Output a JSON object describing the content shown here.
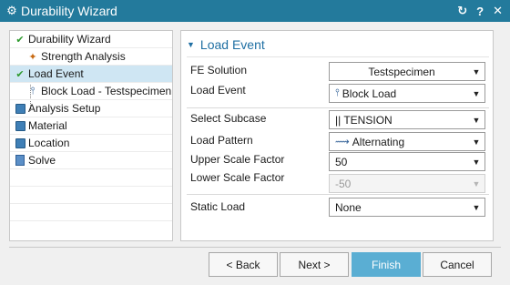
{
  "window": {
    "title": "Durability Wizard",
    "controls": [
      "↻",
      "?",
      "✕"
    ]
  },
  "tree": {
    "items": [
      {
        "label": "Durability Wizard",
        "icon": "check-icon",
        "indent": 0
      },
      {
        "label": "Strength Analysis",
        "icon": "strength-analysis-icon",
        "indent": 1
      },
      {
        "label": "Load Event",
        "icon": "check-icon",
        "indent": 0,
        "selected": true
      },
      {
        "label": "Block Load - Testspecimen",
        "icon": "block-load-icon",
        "indent": 1
      },
      {
        "label": "Analysis Setup",
        "icon": "setup-icon",
        "indent": 0
      },
      {
        "label": "Material",
        "icon": "material-icon",
        "indent": 0
      },
      {
        "label": "Location",
        "icon": "location-icon",
        "indent": 0
      },
      {
        "label": "Solve",
        "icon": "solve-icon",
        "indent": 0
      }
    ]
  },
  "load_event": {
    "section_title": "Load Event",
    "fe_solution_label": "FE Solution",
    "fe_solution_value": "Testspecimen",
    "load_event_label": "Load Event",
    "load_event_value": "Block Load",
    "select_subcase_label": "Select Subcase",
    "select_subcase_value": "|| TENSION",
    "load_pattern_label": "Load Pattern",
    "load_pattern_value": "Alternating",
    "upper_scale_label": "Upper Scale Factor",
    "upper_scale_value": "50",
    "lower_scale_label": "Lower Scale Factor",
    "lower_scale_value": "-50",
    "static_load_label": "Static Load",
    "static_load_value": "None"
  },
  "buttons": {
    "back": "< Back",
    "next": "Next >",
    "finish": "Finish",
    "cancel": "Cancel"
  },
  "colors": {
    "titlebar": "#237a9c",
    "accent": "#1f6fa3",
    "selected_row": "#cfe6f3",
    "finish_button": "#5aaed3"
  }
}
